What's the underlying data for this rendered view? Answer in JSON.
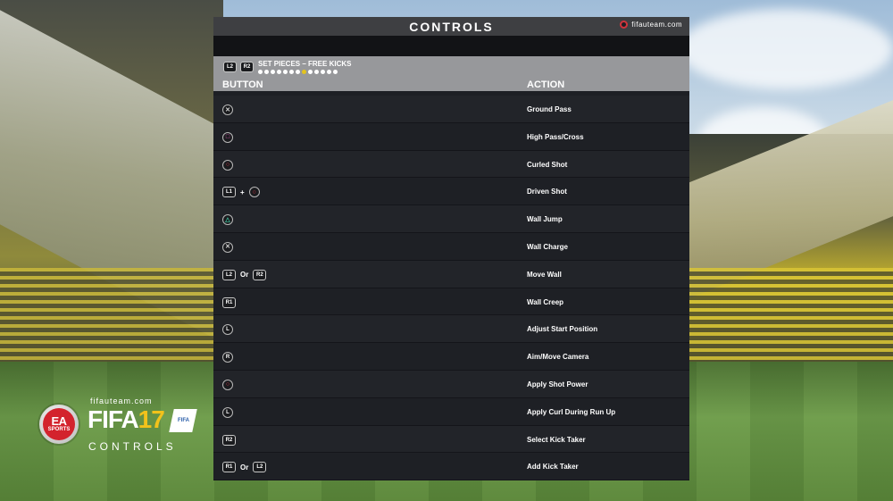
{
  "header": {
    "title": "CONTROLS",
    "brand": "fifauteam.com"
  },
  "section": {
    "buttons": [
      "L2",
      "R2"
    ],
    "name": "SET PIECES – FREE KICKS",
    "page_dots_total": 13,
    "page_dots_active_index": 7
  },
  "columns": {
    "button": "BUTTON",
    "action": "ACTION"
  },
  "rows": [
    {
      "buttons": [
        {
          "kind": "face",
          "symbol": "cross"
        }
      ],
      "action": "Ground Pass"
    },
    {
      "buttons": [
        {
          "kind": "face",
          "symbol": "square"
        }
      ],
      "action": "High Pass/Cross"
    },
    {
      "buttons": [
        {
          "kind": "face",
          "symbol": "circle"
        }
      ],
      "action": "Curled Shot"
    },
    {
      "buttons": [
        {
          "kind": "tag",
          "label": "L1"
        },
        {
          "kind": "conj",
          "label": "+"
        },
        {
          "kind": "face",
          "symbol": "circle"
        }
      ],
      "action": "Driven Shot"
    },
    {
      "buttons": [
        {
          "kind": "face",
          "symbol": "triangle"
        }
      ],
      "action": "Wall Jump"
    },
    {
      "buttons": [
        {
          "kind": "face",
          "symbol": "cross"
        }
      ],
      "action": "Wall Charge"
    },
    {
      "buttons": [
        {
          "kind": "tag",
          "label": "L2"
        },
        {
          "kind": "conj",
          "label": "Or"
        },
        {
          "kind": "tag",
          "label": "R2"
        }
      ],
      "action": "Move Wall"
    },
    {
      "buttons": [
        {
          "kind": "tag",
          "label": "R1"
        }
      ],
      "action": "Wall Creep"
    },
    {
      "buttons": [
        {
          "kind": "stick",
          "label": "L"
        }
      ],
      "action": "Adjust Start Position"
    },
    {
      "buttons": [
        {
          "kind": "stick",
          "label": "R"
        }
      ],
      "action": "Aim/Move Camera"
    },
    {
      "buttons": [
        {
          "kind": "face",
          "symbol": "circle"
        }
      ],
      "action": "Apply Shot Power"
    },
    {
      "buttons": [
        {
          "kind": "stick",
          "label": "L"
        }
      ],
      "action": "Apply Curl During Run Up"
    },
    {
      "buttons": [
        {
          "kind": "tag",
          "label": "R2"
        }
      ],
      "action": "Select Kick Taker"
    },
    {
      "buttons": [
        {
          "kind": "tag",
          "label": "R1"
        },
        {
          "kind": "conj",
          "label": "Or"
        },
        {
          "kind": "tag",
          "label": "L2"
        }
      ],
      "action": "Add Kick Taker"
    }
  ],
  "logo": {
    "site": "fifauteam.com",
    "ea_text": "EA",
    "ea_sub": "SPORTS",
    "game_word": "FIFA",
    "game_number": "17",
    "caption": "CONTROLS"
  },
  "colors": {
    "active_dot": "#e4c41e",
    "cross": "#d8d8d8",
    "square": "#e05fb8",
    "circle": "#e8394a",
    "triangle": "#3fc6a1",
    "brand_red": "#d0343c"
  }
}
